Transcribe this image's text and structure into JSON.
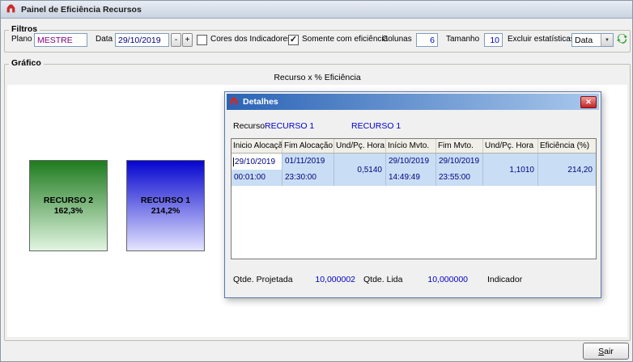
{
  "window": {
    "title": "Painel de Eficiência Recursos"
  },
  "filters": {
    "group_label": "Filtros",
    "plano": {
      "label": "Plano",
      "value": "MESTRE"
    },
    "data": {
      "label": "Data",
      "value": "29/10/2019",
      "minus": "-",
      "plus": "+"
    },
    "cores_indicadores": {
      "label": "Cores dos Indicadores",
      "checked": false
    },
    "somente_eficiencia": {
      "label": "Somente com eficiência",
      "checked": true
    },
    "colunas": {
      "label": "Colunas",
      "value": "6"
    },
    "tamanho": {
      "label": "Tamanho",
      "value": "10"
    },
    "excluir_estatisticas": {
      "label": "Excluir estatísticas",
      "value": "Data"
    }
  },
  "chart_data": {
    "type": "bar",
    "title": "Recurso x % Eficiência",
    "categories": [
      "RECURSO 2",
      "RECURSO 1"
    ],
    "values": [
      162.3,
      214.2
    ],
    "value_labels": [
      "162,3%",
      "214,2%"
    ],
    "xlabel": "",
    "ylabel": "% Eficiência"
  },
  "chart": {
    "group_label": "Gráfico",
    "title": "Recurso x % Eficiência",
    "bars": [
      {
        "name": "RECURSO 2",
        "value_label": "162,3%",
        "color_top": "#1e7b1e",
        "color_bottom": "#e2f5e2"
      },
      {
        "name": "RECURSO 1",
        "value_label": "214,2%",
        "color_top": "#0404cf",
        "color_bottom": "#e4e4ff"
      }
    ]
  },
  "dialog": {
    "title": "Detalhes",
    "recurso_label": "Recurso",
    "recurso_code": "RECURSO 1",
    "recurso_name": "RECURSO 1",
    "grid": {
      "headers": [
        "Inicio Alocação",
        "Fim Alocação",
        "Und/Pç. Hora",
        "Início Mvto.",
        "Fim Mvto.",
        "Und/Pç. Hora",
        "Eficiência (%)"
      ],
      "row": {
        "inicio_alocacao": {
          "date": "29/10/2019",
          "time": "00:01:00"
        },
        "fim_alocacao": {
          "date": "01/11/2019",
          "time": "23:30:00"
        },
        "und_pc_hora_alocacao": "0,5140",
        "inicio_mvto": {
          "date": "29/10/2019",
          "time": "14:49:49"
        },
        "fim_mvto": {
          "date": "29/10/2019",
          "time": "23:55:00"
        },
        "und_pc_hora_mvto": "1,1010",
        "eficiencia": "214,20"
      }
    },
    "footer": {
      "qtde_projetada_label": "Qtde. Projetada",
      "qtde_projetada_value": "10,000002",
      "qtde_lida_label": "Qtde. Lida",
      "qtde_lida_value": "10,000000",
      "indicador_label": "Indicador"
    }
  },
  "actions": {
    "sair_label": "Sair"
  },
  "icons": {
    "check": "✓",
    "close": "✕",
    "dropdown": "▼"
  },
  "colors": {
    "value_text": "#0000c8",
    "plano_text": "#800080",
    "row_selection": "#c9def4",
    "dialog_titlebar_start": "#2a63b5",
    "dialog_titlebar_end": "#a9c8ec"
  }
}
